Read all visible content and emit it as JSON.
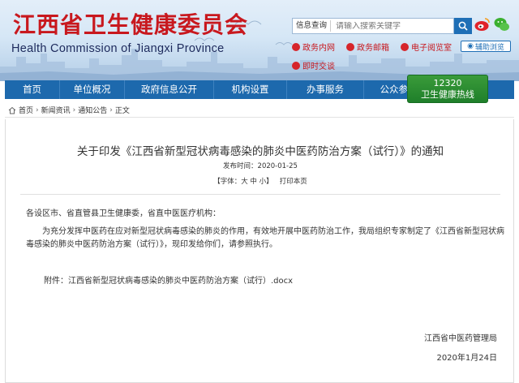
{
  "header": {
    "title_cn": "江西省卫生健康委员会",
    "title_en": "Health Commission of Jiangxi Province",
    "search": {
      "category": "信息查询",
      "placeholder": "请输入搜索关键字"
    },
    "links": [
      {
        "label": "政务内网",
        "icon": "globe-icon"
      },
      {
        "label": "政务邮箱",
        "icon": "mail-icon"
      },
      {
        "label": "电子阅览室",
        "icon": "screen-icon"
      }
    ],
    "access_label": "辅助浏览",
    "link_extra": "即时交谈",
    "colors": {
      "title_red": "#c8181e",
      "nav_blue": "#1d69ad",
      "hotline_green": "#2a8c2f"
    }
  },
  "nav": {
    "items": [
      "首页",
      "单位概况",
      "政府信息公开",
      "机构设置",
      "办事服务",
      "公众参与"
    ],
    "hotline": {
      "number": "12320",
      "label": "卫生健康热线"
    }
  },
  "breadcrumb": [
    "首页",
    "新闻资讯",
    "通知公告",
    "正文"
  ],
  "article": {
    "title": "关于印发《江西省新型冠状病毒感染的肺炎中医药防治方案（试行）》的通知",
    "publish_label": "发布时间：",
    "publish_date": "2020-01-25",
    "font_controls": "【字体：大 中 小】",
    "print_label": "打印本页",
    "greeting": "各设区市、省直管县卫生健康委，省直中医医疗机构：",
    "paragraph": "为充分发挥中医药在应对新型冠状病毒感染的肺炎的作用，有效地开展中医药防治工作，我局组织专家制定了《江西省新型冠状病毒感染的肺炎中医药防治方案（试行）》，现印发给你们，请参照执行。",
    "attachment": "附件：江西省新型冠状病毒感染的肺炎中医药防治方案（试行）.docx",
    "signature_org": "江西省中医药管理局",
    "signature_date": "2020年1月24日"
  }
}
